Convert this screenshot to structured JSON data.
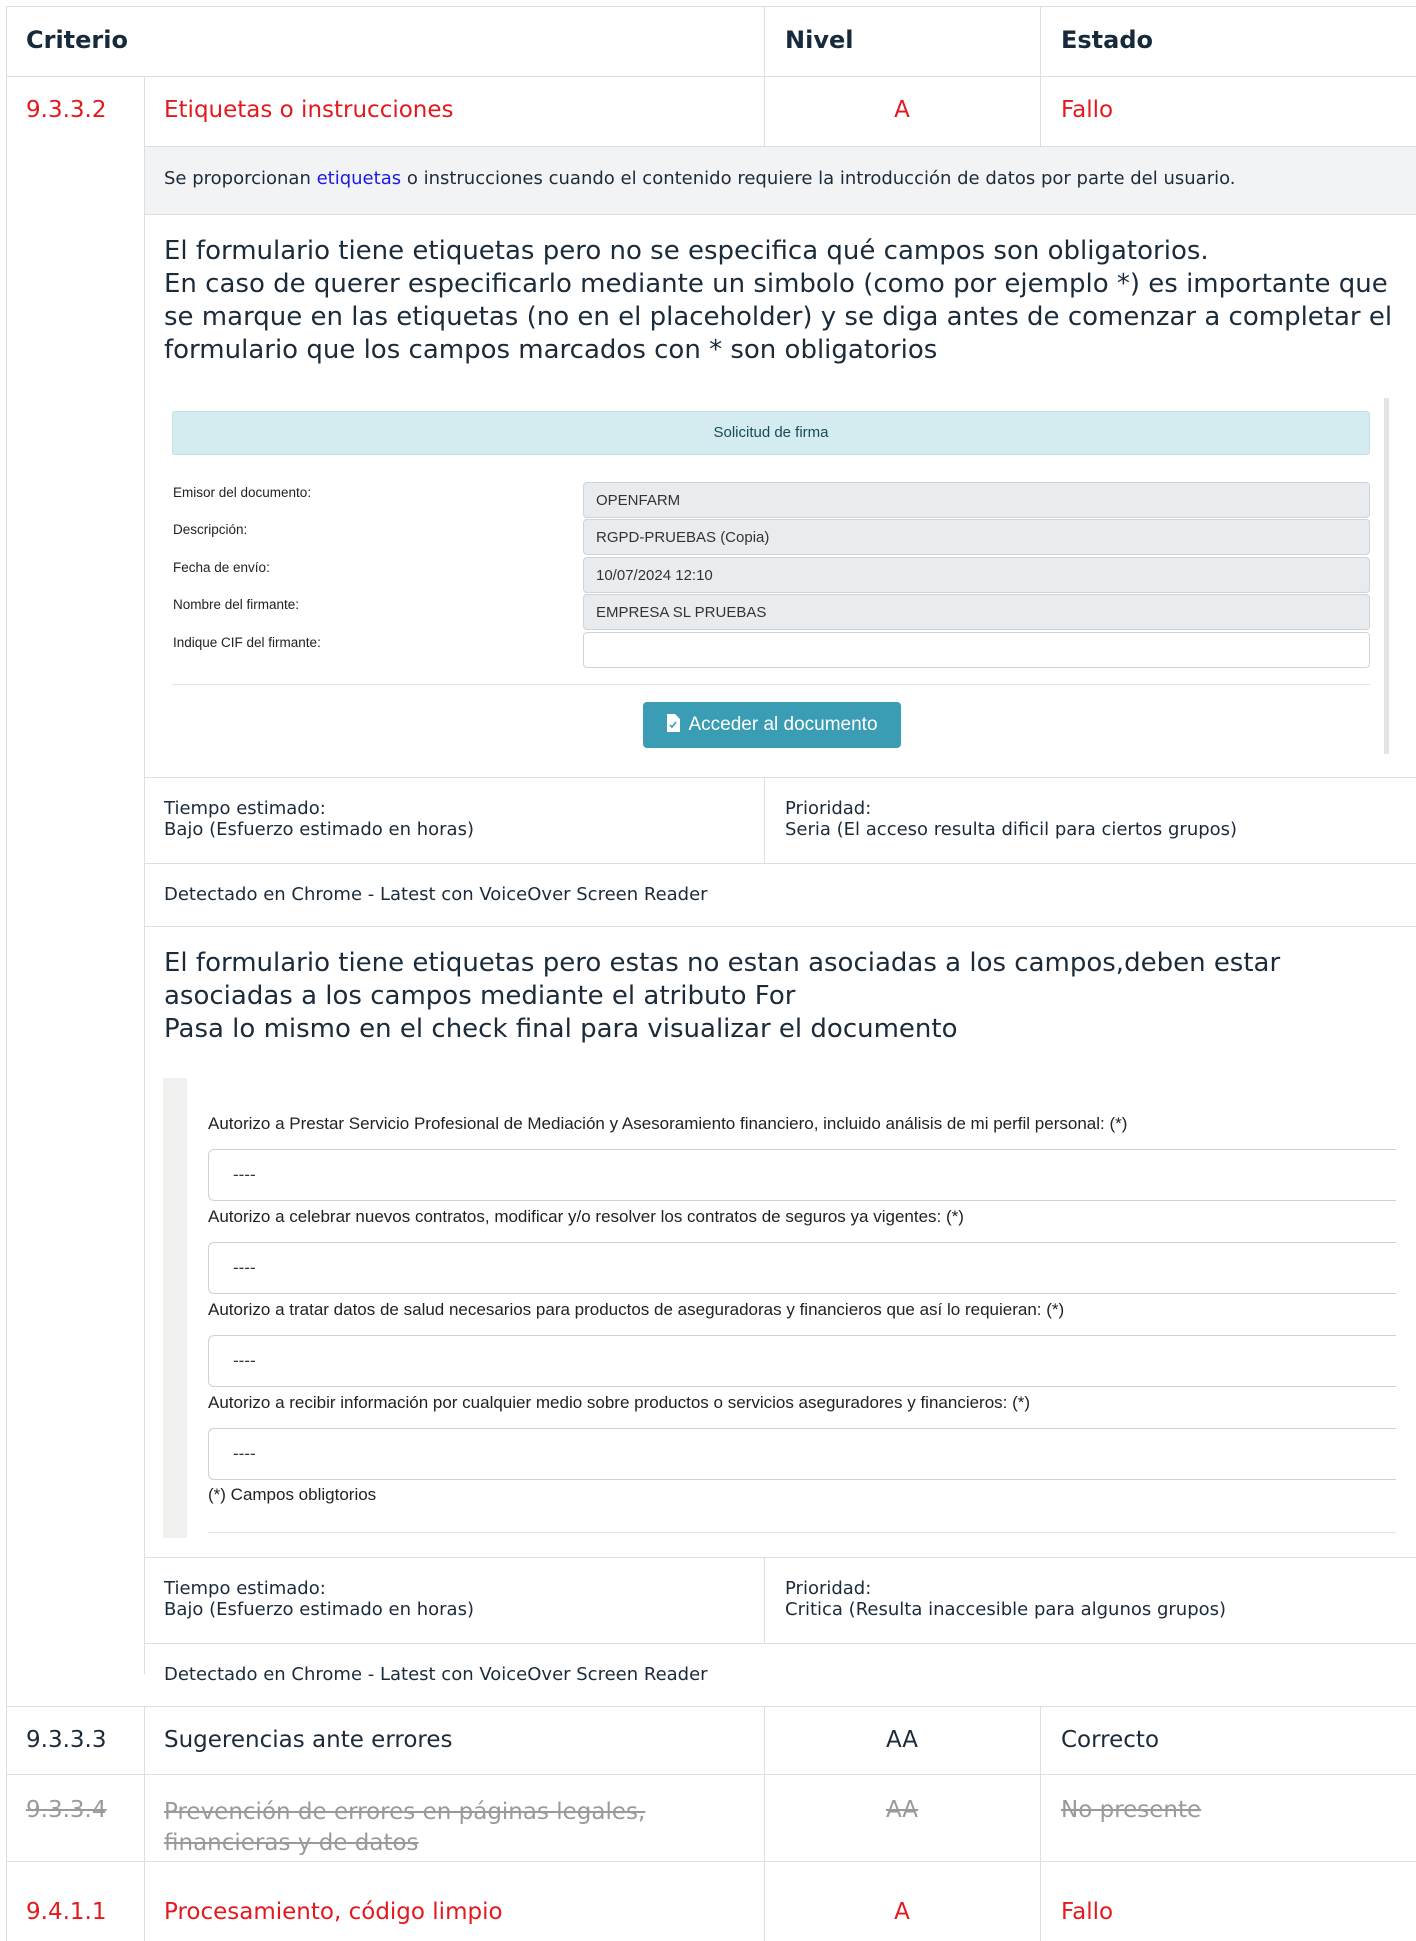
{
  "header": {
    "criterio": "Criterio",
    "nivel": "Nivel",
    "estado": "Estado"
  },
  "rows": [
    {
      "code": "9.3.3.2",
      "name": "Etiquetas o instrucciones",
      "level": "A",
      "status": "Fallo",
      "color": "#e3191e"
    },
    {
      "code": "9.3.3.3",
      "name": "Sugerencias ante errores",
      "level": "AA",
      "status": "Correcto"
    },
    {
      "code": "9.3.3.4",
      "name": "Prevención de errores en páginas legales, financieras y de datos",
      "level": "AA",
      "status": "No presente"
    },
    {
      "code": "9.4.1.1",
      "name": "Procesamiento, código limpio",
      "level": "A",
      "status": "Fallo"
    }
  ],
  "description": {
    "before": "Se proporcionan ",
    "link": "etiquetas",
    "after": " o instrucciones cuando el contenido requiere la introducción de datos por parte del usuario."
  },
  "issue1": {
    "text": "El formulario tiene etiquetas pero no se especifica qué campos son obligatorios.\nEn caso de querer especificarlo mediante un simbolo (como por ejemplo *) es importante que se marque en las etiquetas (no en el placeholder) y se diga antes de comenzar a completar el formulario que los campos marcados con * son obligatorios",
    "screenshot": {
      "title": "Solicitud de firma",
      "fields": [
        {
          "label": "Emisor del documento:",
          "value": "OPENFARM"
        },
        {
          "label": "Descripción:",
          "value": "RGPD-PRUEBAS (Copia)"
        },
        {
          "label": "Fecha de envío:",
          "value": "10/07/2024 12:10"
        },
        {
          "label": "Nombre del firmante:",
          "value": "EMPRESA SL PRUEBAS"
        },
        {
          "label": "Indique CIF del firmante:",
          "value": ""
        }
      ],
      "button": "Acceder al documento"
    },
    "time_label": "Tiempo estimado:",
    "time_value": "Bajo (Esfuerzo estimado en horas)",
    "priority_label": "Prioridad:",
    "priority_value": "Seria (El acceso resulta dificil para ciertos grupos)",
    "detected": "Detectado en Chrome - Latest con VoiceOver Screen Reader"
  },
  "issue2": {
    "text": "El formulario tiene etiquetas pero estas no estan asociadas a los campos,deben estar asociadas a los campos mediante el atributo For\nPasa lo mismo en el check final para visualizar el documento",
    "screenshot": {
      "items": [
        {
          "label": "Autorizo a Prestar Servicio Profesional de Mediación y Asesoramiento financiero, incluido análisis de mi perfil personal: (*)",
          "value": "----"
        },
        {
          "label": "Autorizo a celebrar nuevos contratos, modificar y/o resolver los contratos de seguros ya vigentes: (*)",
          "value": "----"
        },
        {
          "label": "Autorizo a tratar datos de salud necesarios para productos de aseguradoras y financieros que así lo requieran: (*)",
          "value": "----"
        },
        {
          "label": "Autorizo a recibir información por cualquier medio sobre productos o servicios aseguradores y financieros: (*)",
          "value": "----"
        }
      ],
      "footnote": "(*) Campos obligtorios"
    },
    "time_label": "Tiempo estimado:",
    "time_value": "Bajo (Esfuerzo estimado en horas)",
    "priority_label": "Prioridad:",
    "priority_value": "Critica (Resulta inaccesible para algunos grupos)",
    "detected": "Detectado en Chrome - Latest con VoiceOver Screen Reader"
  }
}
